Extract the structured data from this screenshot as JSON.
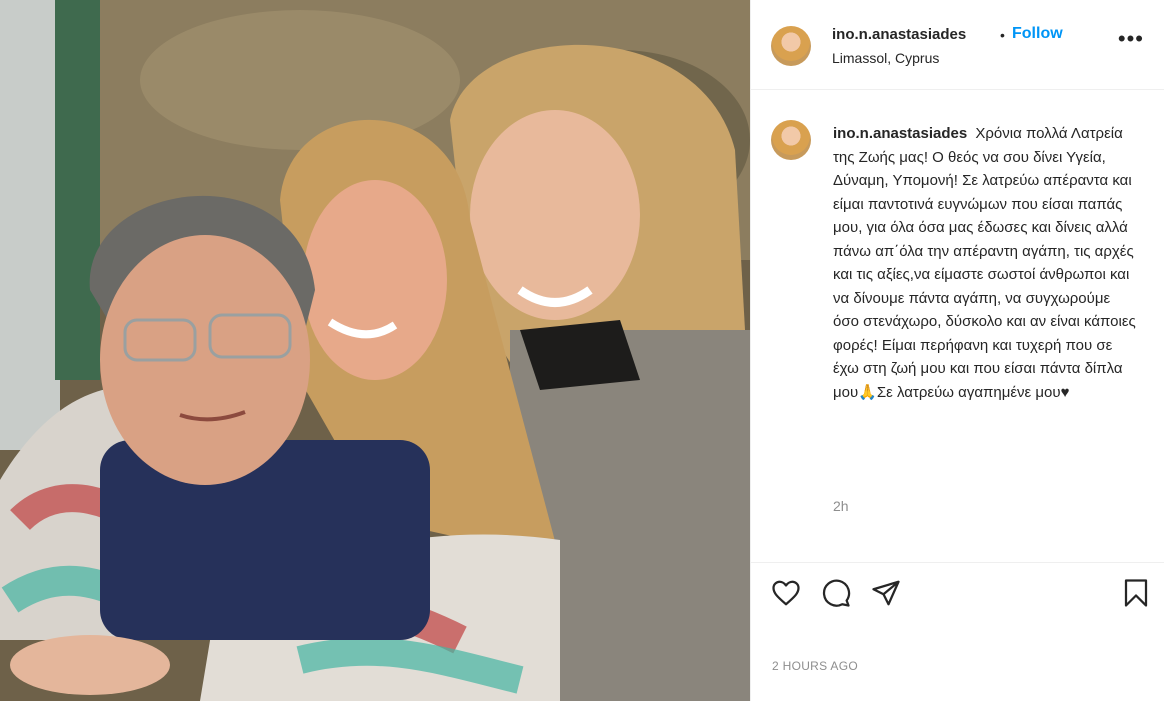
{
  "header": {
    "username": "ino.n.anastasiades",
    "separator": "•",
    "follow_label": "Follow",
    "location": "Limassol, Cyprus",
    "more_label": "•••"
  },
  "caption": {
    "username": "ino.n.anastasiades",
    "text": "Χρόνια πολλά Λατρεία της Ζωής μας! Ο θεός να σου δίνει Υγεία, Δύναμη, Υπομονή! Σε λατρεύω απέραντα και είμαι παντοτινά ευγνώμων που είσαι παπάς μου, για όλα όσα μας έδωσες και δίνεις αλλά πάνω απ΄όλα την απέραντη αγάπη, τις αρχές και τις αξίες,να είμαστε σωστοί άνθρωποι και να δίνουμε πάντα αγάπη, να συγχωρούμε όσο στενάχωρο, δύσκολο και αν είναι κάποιες φορές! Είμαι περήφανη και τυχερή που σε έχω στη ζωή μου και που είσαι πάντα δίπλα μου🙏Σε λατρεύω αγαπημένε μου♥",
    "time": "2h"
  },
  "actions": {
    "like_icon": "heart-icon",
    "comment_icon": "comment-icon",
    "share_icon": "paper-plane-icon",
    "save_icon": "bookmark-icon"
  },
  "footer": {
    "date": "2 HOURS AGO"
  },
  "colors": {
    "accent": "#0095f6",
    "text": "#262626",
    "muted": "#8e8e8e",
    "border": "#efefef"
  }
}
